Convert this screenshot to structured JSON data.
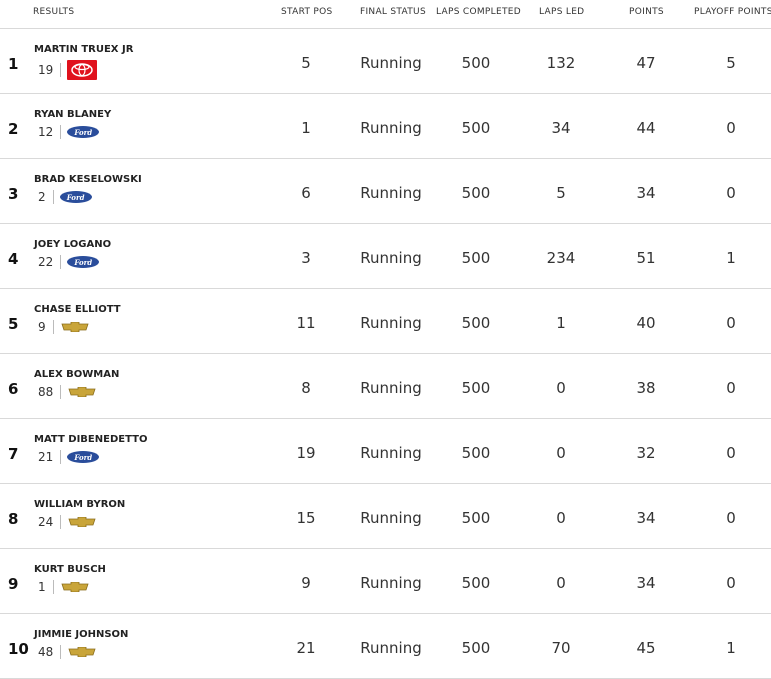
{
  "columns": {
    "results": "RESULTS",
    "start_pos": "START POS",
    "final_status": "FINAL STATUS",
    "laps_completed": "LAPS COMPLETED",
    "laps_led": "LAPS LED",
    "points": "POINTS",
    "playoff_points": "PLAYOFF POINTS"
  },
  "colors": {
    "toyota": "#e0121d",
    "ford": "#2a4d9b",
    "chevrolet": "#c9a53a"
  },
  "rows": [
    {
      "pos": "1",
      "driver": "MARTIN TRUEX JR",
      "car": "19",
      "make": "toyota-logo",
      "start": "5",
      "status": "Running",
      "laps": "500",
      "led": "132",
      "points": "47",
      "playoff": "5"
    },
    {
      "pos": "2",
      "driver": "RYAN BLANEY",
      "car": "12",
      "make": "ford-logo",
      "start": "1",
      "status": "Running",
      "laps": "500",
      "led": "34",
      "points": "44",
      "playoff": "0"
    },
    {
      "pos": "3",
      "driver": "BRAD KESELOWSKI",
      "car": "2",
      "make": "ford-logo",
      "start": "6",
      "status": "Running",
      "laps": "500",
      "led": "5",
      "points": "34",
      "playoff": "0"
    },
    {
      "pos": "4",
      "driver": "JOEY LOGANO",
      "car": "22",
      "make": "ford-logo",
      "start": "3",
      "status": "Running",
      "laps": "500",
      "led": "234",
      "points": "51",
      "playoff": "1"
    },
    {
      "pos": "5",
      "driver": "CHASE ELLIOTT",
      "car": "9",
      "make": "chevrolet-logo",
      "start": "11",
      "status": "Running",
      "laps": "500",
      "led": "1",
      "points": "40",
      "playoff": "0"
    },
    {
      "pos": "6",
      "driver": "ALEX BOWMAN",
      "car": "88",
      "make": "chevrolet-logo",
      "start": "8",
      "status": "Running",
      "laps": "500",
      "led": "0",
      "points": "38",
      "playoff": "0"
    },
    {
      "pos": "7",
      "driver": "MATT DIBENEDETTO",
      "car": "21",
      "make": "ford-logo",
      "start": "19",
      "status": "Running",
      "laps": "500",
      "led": "0",
      "points": "32",
      "playoff": "0"
    },
    {
      "pos": "8",
      "driver": "WILLIAM BYRON",
      "car": "24",
      "make": "chevrolet-logo",
      "start": "15",
      "status": "Running",
      "laps": "500",
      "led": "0",
      "points": "34",
      "playoff": "0"
    },
    {
      "pos": "9",
      "driver": "KURT BUSCH",
      "car": "1",
      "make": "chevrolet-logo",
      "start": "9",
      "status": "Running",
      "laps": "500",
      "led": "0",
      "points": "34",
      "playoff": "0"
    },
    {
      "pos": "10",
      "driver": "JIMMIE JOHNSON",
      "car": "48",
      "make": "chevrolet-logo",
      "start": "21",
      "status": "Running",
      "laps": "500",
      "led": "70",
      "points": "45",
      "playoff": "1"
    }
  ]
}
